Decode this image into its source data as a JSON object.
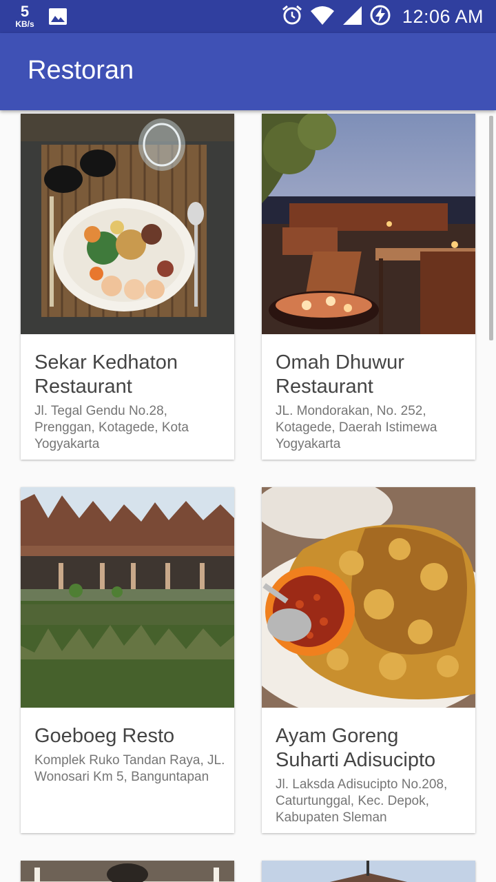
{
  "status_bar": {
    "speed_value": "5",
    "speed_unit": "KB/s",
    "time": "12:06 AM",
    "icons": [
      "image-icon",
      "alarm-icon",
      "wifi-icon",
      "signal-icon",
      "battery-charging-icon"
    ]
  },
  "app_bar": {
    "title": "Restoran",
    "color": "#3f51b5",
    "status_color": "#303f9f"
  },
  "restaurants": [
    {
      "name": "Sekar Kedhaton Restaurant",
      "address": "Jl. Tegal Gendu No.28, Prenggan, Kotagede, Kota Yogyakarta",
      "photo": "food-plate-photo"
    },
    {
      "name": "Omah Dhuwur Restaurant",
      "address": "JL. Mondorakan, No. 252, Kotagede, Daerah Istimewa Yogyakarta",
      "photo": "rooftop-dining-photo"
    },
    {
      "name": "Goeboeg Resto",
      "address": "Komplek Ruko Tandan Raya, JL. Wonosari Km 5, Banguntapan",
      "photo": "pond-restaurant-photo"
    },
    {
      "name": "Ayam Goreng Suharti Adisucipto",
      "address": " Jl. Laksda Adisucipto No.208, Caturtunggal, Kec. Depok, Kabupaten Sleman",
      "photo": "fried-chicken-photo"
    }
  ]
}
